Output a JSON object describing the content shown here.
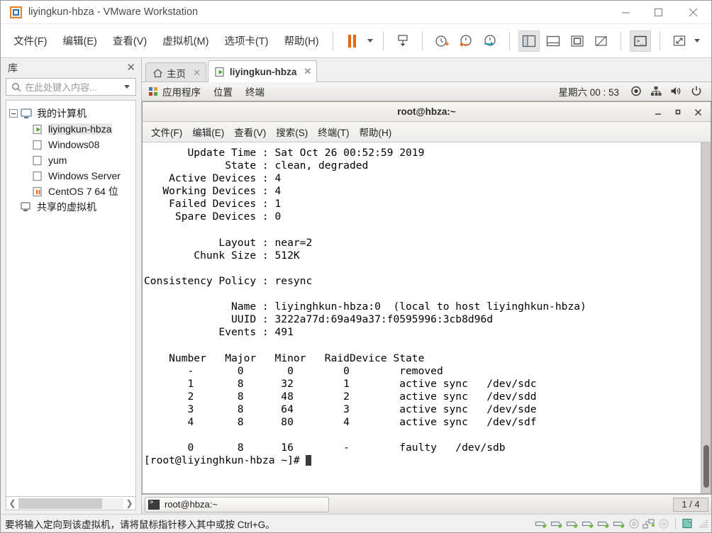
{
  "window": {
    "title": "liyingkun-hbza - VMware Workstation",
    "logo_icon": "vmware-logo-icon",
    "controls": [
      {
        "name": "minimize-button",
        "icon": "minimize-icon"
      },
      {
        "name": "maximize-button",
        "icon": "maximize-icon"
      },
      {
        "name": "close-button",
        "icon": "close-icon"
      }
    ]
  },
  "menubar": {
    "items": [
      {
        "label": "文件(F)",
        "name": "menu-file"
      },
      {
        "label": "编辑(E)",
        "name": "menu-edit"
      },
      {
        "label": "查看(V)",
        "name": "menu-view"
      },
      {
        "label": "虚拟机(M)",
        "name": "menu-vm"
      },
      {
        "label": "选项卡(T)",
        "name": "menu-tabs"
      },
      {
        "label": "帮助(H)",
        "name": "menu-help"
      }
    ],
    "toolbar": [
      {
        "name": "suspend-button",
        "icon": "pause-icon"
      },
      {
        "name": "power-dropdown",
        "icon": "chevron-down-icon"
      },
      {
        "name": "send-ctrl-alt-del-button",
        "icon": "keyboard-send-icon"
      },
      {
        "name": "snapshot-take-button",
        "icon": "snapshot-clock-plus-icon"
      },
      {
        "name": "snapshot-revert-button",
        "icon": "snapshot-clock-back-icon"
      },
      {
        "name": "snapshot-manager-button",
        "icon": "snapshot-clock-manage-icon"
      },
      {
        "name": "show-library-button",
        "icon": "panel-left-icon"
      },
      {
        "name": "show-thumbnail-bar-button",
        "icon": "panel-bottom-icon"
      },
      {
        "name": "full-screen-button",
        "icon": "fullscreen-icon"
      },
      {
        "name": "unity-mode-button",
        "icon": "unity-off-icon"
      },
      {
        "name": "console-view-button",
        "icon": "terminal-icon"
      },
      {
        "name": "stretch-guest-button",
        "icon": "expand-arrows-icon"
      },
      {
        "name": "stretch-dropdown",
        "icon": "chevron-down-icon"
      }
    ]
  },
  "library": {
    "title": "库",
    "close_icon": "close-icon",
    "search": {
      "placeholder": "在此处键入内容...",
      "icon": "search-icon",
      "dropdown_icon": "chevron-down-icon"
    },
    "tree": [
      {
        "label": "我的计算机",
        "icon": "computer-icon",
        "level": 0,
        "expanded": true,
        "selected": false
      },
      {
        "label": "liyingkun-hbza",
        "icon": "vm-running-icon",
        "level": 1,
        "selected": true
      },
      {
        "label": "Windows08",
        "icon": "vm-off-icon",
        "level": 1,
        "selected": false
      },
      {
        "label": "yum",
        "icon": "vm-off-icon",
        "level": 1,
        "selected": false
      },
      {
        "label": "Windows Server",
        "icon": "vm-off-icon",
        "level": 1,
        "selected": false
      },
      {
        "label": "CentOS 7 64 位",
        "icon": "vm-suspended-icon",
        "level": 1,
        "selected": false
      },
      {
        "label": "共享的虚拟机",
        "icon": "shared-vms-icon",
        "level": 0,
        "selected": false
      }
    ],
    "hscroll": {
      "left_icon": "chevron-left-icon",
      "right_icon": "chevron-right-icon"
    }
  },
  "tabs": [
    {
      "label": "主页",
      "icon": "home-icon",
      "active": false,
      "close_icon": "close-icon",
      "name": "tab-home"
    },
    {
      "label": "liyingkun-hbza",
      "icon": "vm-running-icon",
      "active": true,
      "close_icon": "close-icon",
      "name": "tab-liyingkun-hbza"
    }
  ],
  "guest_panel": {
    "items": [
      {
        "label": "应用程序",
        "icon": "applications-icon",
        "name": "gnome-applications-menu"
      },
      {
        "label": "位置",
        "icon": "",
        "name": "gnome-places-menu"
      },
      {
        "label": "终端",
        "icon": "",
        "name": "gnome-terminal-menu"
      }
    ],
    "clock": "星期六 00 : 53",
    "tray": [
      {
        "name": "accessibility-icon",
        "icon": "record-dot-icon"
      },
      {
        "name": "network-icon",
        "icon": "network-wired-icon"
      },
      {
        "name": "volume-icon",
        "icon": "speaker-icon"
      },
      {
        "name": "power-icon",
        "icon": "power-icon"
      }
    ]
  },
  "terminal": {
    "title": "root@hbza:~",
    "controls": [
      {
        "name": "terminal-minimize-button",
        "icon": "minimize-icon"
      },
      {
        "name": "terminal-maximize-button",
        "icon": "maximize-icon"
      },
      {
        "name": "terminal-close-button",
        "icon": "close-icon"
      }
    ],
    "menu": [
      {
        "label": "文件(F)",
        "name": "terminal-menu-file"
      },
      {
        "label": "编辑(E)",
        "name": "terminal-menu-edit"
      },
      {
        "label": "查看(V)",
        "name": "terminal-menu-view"
      },
      {
        "label": "搜索(S)",
        "name": "terminal-menu-search"
      },
      {
        "label": "终端(T)",
        "name": "terminal-menu-terminal"
      },
      {
        "label": "帮助(H)",
        "name": "terminal-menu-help"
      }
    ],
    "output": "       Update Time : Sat Oct 26 00:52:59 2019\n             State : clean, degraded\n    Active Devices : 4\n   Working Devices : 4\n    Failed Devices : 1\n     Spare Devices : 0\n\n            Layout : near=2\n        Chunk Size : 512K\n\nConsistency Policy : resync\n\n              Name : liyinghkun-hbza:0  (local to host liyinghkun-hbza)\n              UUID : 3222a77d:69a49a37:f0595996:3cb8d96d\n            Events : 491\n\n    Number   Major   Minor   RaidDevice State\n       -       0       0        0        removed\n       1       8      32        1        active sync   /dev/sdc\n       2       8      48        2        active sync   /dev/sdd\n       3       8      64        3        active sync   /dev/sde\n       4       8      80        4        active sync   /dev/sdf\n\n       0       8      16        -        faulty   /dev/sdb\n",
    "prompt": "[root@liyinghkun-hbza ~]# ",
    "scrollbar": {
      "name": "terminal-scrollbar"
    }
  },
  "guest_taskbar": {
    "tasks": [
      {
        "label": "root@hbza:~",
        "icon": "terminal-icon",
        "name": "taskbar-item-terminal"
      }
    ],
    "workspace": "1 / 4"
  },
  "statusbar": {
    "text": "要将输入定向到该虚拟机，请将鼠标指针移入其中或按 Ctrl+G。",
    "device_icons": [
      {
        "name": "hard-disk-icon",
        "icon": "disk-icon"
      },
      {
        "name": "hard-disk-2-icon",
        "icon": "disk-icon"
      },
      {
        "name": "hard-disk-3-icon",
        "icon": "disk-icon"
      },
      {
        "name": "hard-disk-4-icon",
        "icon": "disk-icon"
      },
      {
        "name": "hard-disk-5-icon",
        "icon": "disk-icon"
      },
      {
        "name": "hard-disk-6-icon",
        "icon": "disk-icon"
      },
      {
        "name": "cd-dvd-icon",
        "icon": "optical-disc-icon"
      },
      {
        "name": "network-adapter-icon",
        "icon": "network-icon"
      },
      {
        "name": "floppy-icon",
        "icon": "optical-disc-icon"
      },
      {
        "name": "usb-icon",
        "icon": "clipboard-icon"
      }
    ]
  },
  "colors": {
    "brand_orange": "#ec6608",
    "brand_blue": "#2d6fb0",
    "accent_green": "#6abf2a",
    "desktop_bg": "#c9a9a9"
  }
}
